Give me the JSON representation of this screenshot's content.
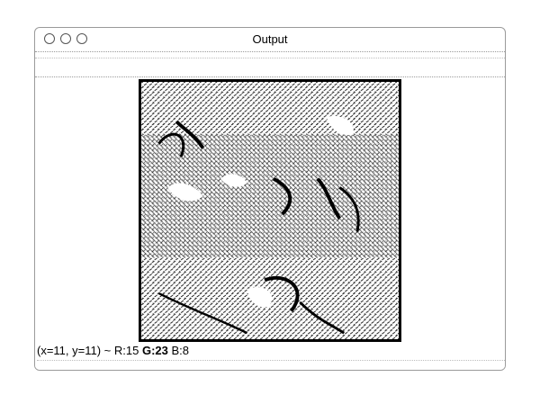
{
  "window": {
    "title": "Output"
  },
  "status": {
    "coords": "(x=11, y=11) ~",
    "r": "R:15",
    "g": "G:23",
    "b": "B:8"
  },
  "image": {
    "description_icon": "edge-detected-image"
  }
}
